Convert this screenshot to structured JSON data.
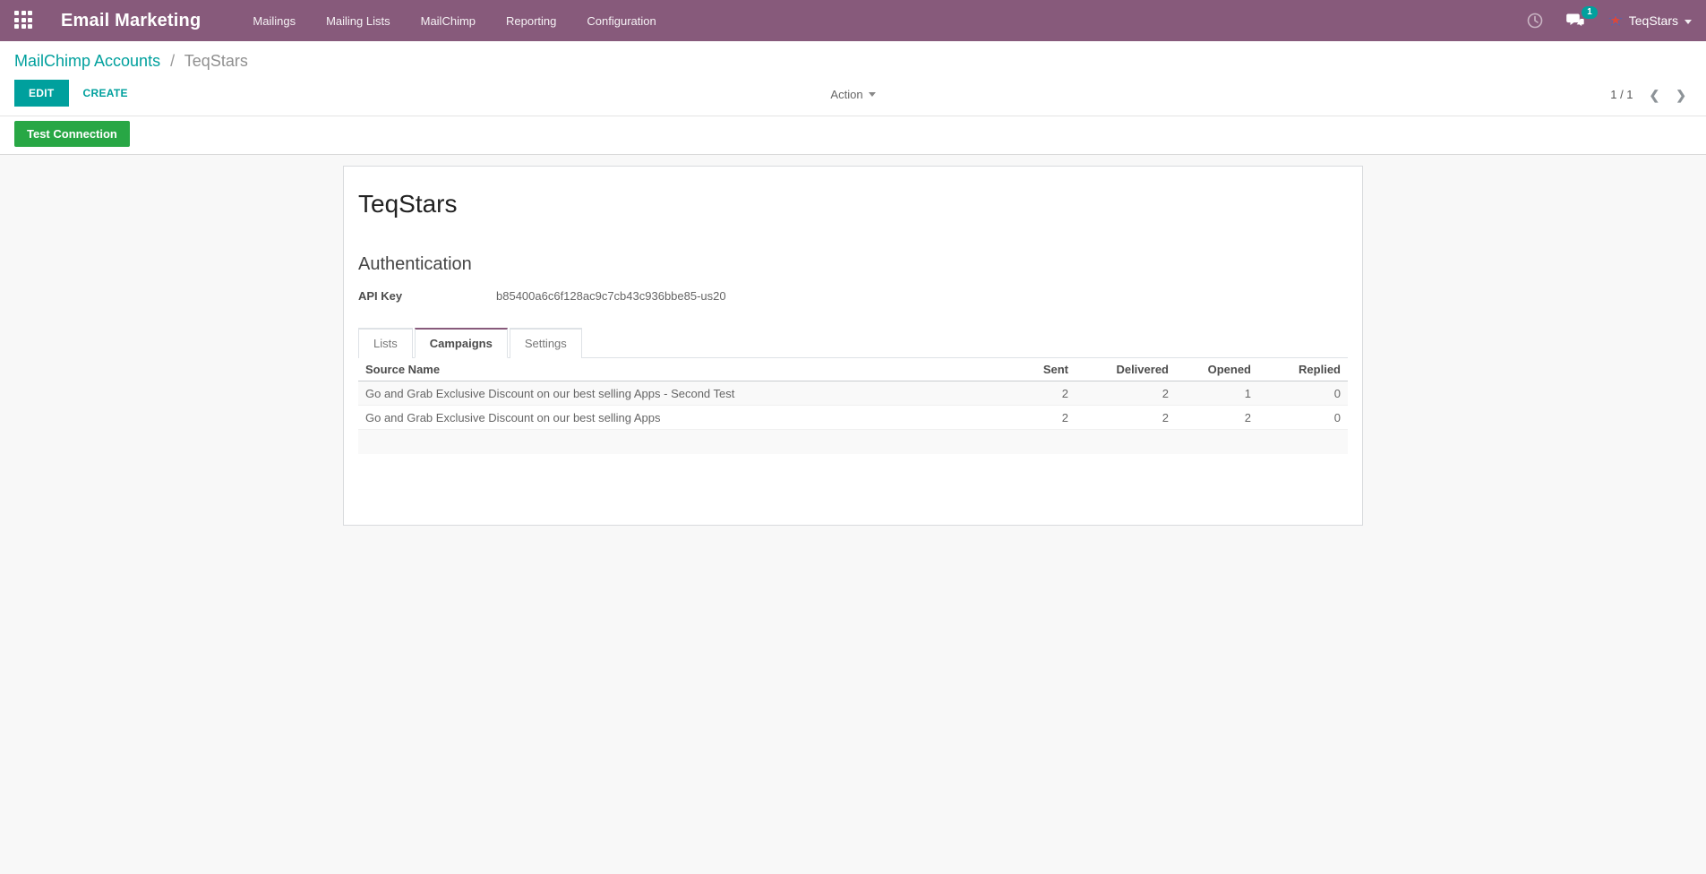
{
  "nav": {
    "brand": "Email Marketing",
    "items": [
      "Mailings",
      "Mailing Lists",
      "MailChimp",
      "Reporting",
      "Configuration"
    ],
    "message_count": "1",
    "user_name": "TeqStars"
  },
  "breadcrumb": {
    "parent": "MailChimp Accounts",
    "separator": "/",
    "current": "TeqStars"
  },
  "toolbar": {
    "edit_label": "EDIT",
    "create_label": "CREATE",
    "action_label": "Action"
  },
  "pager": {
    "value": "1 / 1",
    "prev": "❮",
    "next": "❯"
  },
  "statusbar": {
    "test_connection_label": "Test Connection"
  },
  "record": {
    "title": "TeqStars",
    "section_title": "Authentication",
    "api_key_label": "API Key",
    "api_key_value": "b85400a6c6f128ac9c7cb43c936bbe85-us20"
  },
  "tabs": [
    {
      "label": "Lists"
    },
    {
      "label": "Campaigns"
    },
    {
      "label": "Settings"
    }
  ],
  "campaigns_table": {
    "headers": [
      "Source Name",
      "Sent",
      "Delivered",
      "Opened",
      "Replied"
    ],
    "rows": [
      {
        "source_name": "Go and Grab Exclusive Discount on our best selling Apps - Second Test",
        "sent": "2",
        "delivered": "2",
        "opened": "1",
        "replied": "0"
      },
      {
        "source_name": "Go and Grab Exclusive Discount on our best selling Apps",
        "sent": "2",
        "delivered": "2",
        "opened": "2",
        "replied": "0"
      }
    ]
  },
  "colors": {
    "nav_bg": "#875A7B",
    "primary_teal": "#00A09D",
    "success_green": "#28a745",
    "active_tab_border": "#875A7B"
  }
}
